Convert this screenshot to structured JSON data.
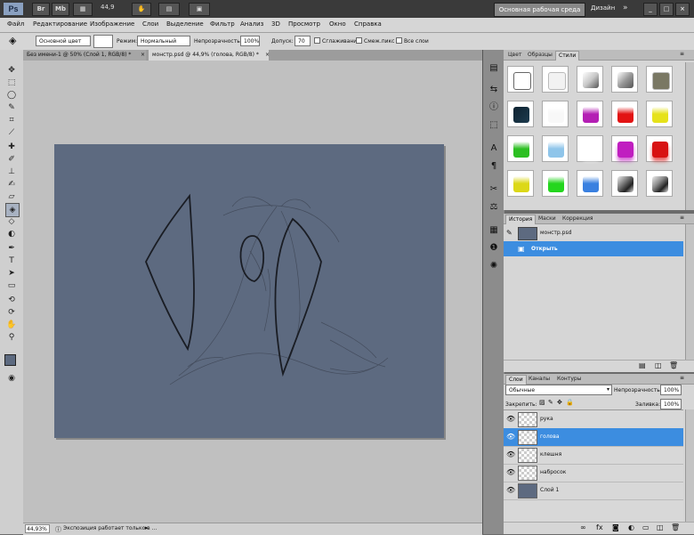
{
  "titlebar": {
    "app_icon": "Ps",
    "bridge_btn": "Br",
    "mini_btn": "Mb",
    "zoom_value": "44,9",
    "workspace_btn": "Основная рабочая среда",
    "design_link": "Дизайн",
    "overflow_icon": "»",
    "window_controls": [
      "_",
      "□",
      "×"
    ]
  },
  "menu": [
    "Файл",
    "Редактирование",
    "Изображение",
    "Слои",
    "Выделение",
    "Фильтр",
    "Анализ",
    "3D",
    "Просмотр",
    "Окно",
    "Справка"
  ],
  "options": {
    "fill_mode": "Основной цвет",
    "mode_label": "Режим:",
    "mode_value": "Нормальный",
    "opacity_label": "Непрозрачность:",
    "opacity_value": "100%",
    "tolerance_label": "Допуск:",
    "tolerance_value": "70",
    "antialias_label": "Сглаживание",
    "contiguous_label": "Смеж.пикс",
    "all_layers_label": "Все слои"
  },
  "tabs": [
    {
      "label": "Без имени-1 @ 50% (Слой 1, RGB/8) *"
    },
    {
      "label": "монстр.psd @ 44,9% (голова, RGB/8) *"
    }
  ],
  "status": {
    "zoom": "44,93%",
    "message": "Экспозиция работает только в ..."
  },
  "style_panel": {
    "tabs": [
      "Цвет",
      "Образцы",
      "Стили"
    ],
    "active_tab": 2,
    "swatches": [
      {
        "color": "#ffffff",
        "style": "outline"
      },
      {
        "color": "#f2f2f2",
        "style": "flat"
      },
      {
        "color": "#c8c8c8",
        "style": "bevel"
      },
      {
        "color": "#9a9a9a",
        "style": "bevel"
      },
      {
        "color": "#7a7864",
        "style": "flat"
      },
      {
        "color": "#1d3b4e",
        "style": "dark"
      },
      {
        "color": "#f8f8f8",
        "style": "glass"
      },
      {
        "color": "#b41fb4",
        "style": "glass"
      },
      {
        "color": "#e21313",
        "style": "glass"
      },
      {
        "color": "#e6e21a",
        "style": "glass"
      },
      {
        "color": "#2cbf22",
        "style": "glass"
      },
      {
        "color": "#8fc5ea",
        "style": "glass"
      },
      {
        "color": "#ffffff",
        "style": "shadow"
      },
      {
        "color": "#c01ec0",
        "style": "shadow"
      },
      {
        "color": "#d81212",
        "style": "shadow"
      },
      {
        "color": "#dcd818",
        "style": "glass"
      },
      {
        "color": "#24d61e",
        "style": "glass"
      },
      {
        "color": "#3a80e0",
        "style": "glass"
      },
      {
        "color": "#7a7a7a",
        "style": "chrome"
      },
      {
        "color": "#8a8a8a",
        "style": "chrome"
      }
    ]
  },
  "history_panel": {
    "tabs": [
      "История",
      "Маски",
      "Коррекция"
    ],
    "document": "монстр.psd",
    "action": "Открыть"
  },
  "layers_panel": {
    "tabs": [
      "Слои",
      "Каналы",
      "Контуры"
    ],
    "blend_mode": "Обычные",
    "opacity_label": "Непрозрачность:",
    "opacity_value": "100%",
    "lock_label": "Закрепить:",
    "fill_label": "Заливка:",
    "fill_value": "100%",
    "layers": [
      {
        "name": "рука",
        "selected": false,
        "thumb": "transparent"
      },
      {
        "name": "голова",
        "selected": true,
        "thumb": "transparent"
      },
      {
        "name": "клешня",
        "selected": false,
        "thumb": "transparent"
      },
      {
        "name": "набросок",
        "selected": false,
        "thumb": "transparent"
      },
      {
        "name": "Слой 1",
        "selected": false,
        "thumb": "fill"
      }
    ]
  },
  "colors": {
    "canvas_fill": "#5d6a80",
    "selection": "#3c8de0",
    "foreground": "#5d6a80",
    "background": "#ffffff"
  }
}
